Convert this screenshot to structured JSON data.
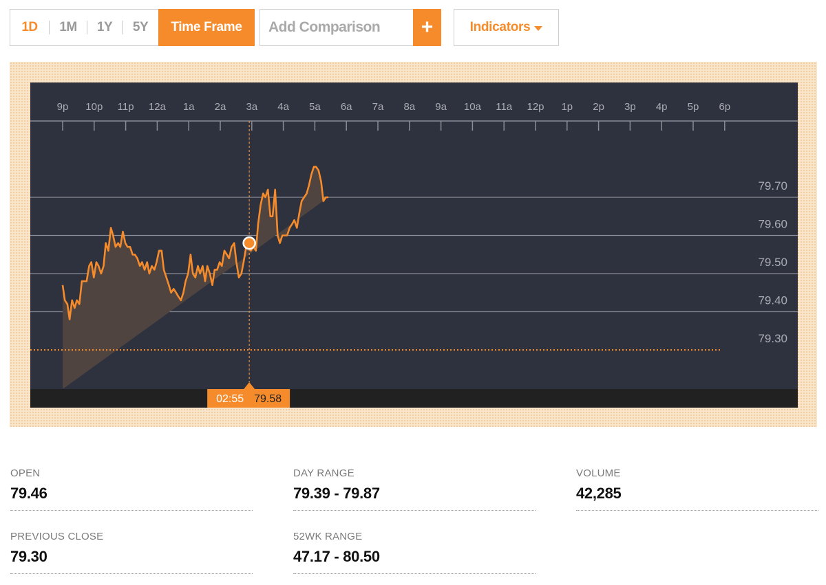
{
  "toolbar": {
    "ranges": [
      {
        "label": "1D",
        "active": true
      },
      {
        "label": "1M",
        "active": false
      },
      {
        "label": "1Y",
        "active": false
      },
      {
        "label": "5Y",
        "active": false
      }
    ],
    "time_frame_label": "Time Frame",
    "comparison_placeholder": "Add Comparison",
    "add_label": "+",
    "indicators_label": "Indicators"
  },
  "colors": {
    "accent": "#f68b2c",
    "plot_bg": "#2d323e",
    "area_fill": "#4f4440",
    "bottom_bar": "#212121",
    "grid": "#8a8d96",
    "axis_text": "#a9acb4"
  },
  "chart_data": {
    "type": "area",
    "x_ticks": [
      "9p",
      "10p",
      "11p",
      "12a",
      "1a",
      "2a",
      "3a",
      "4a",
      "5a",
      "6a",
      "7a",
      "8a",
      "9a",
      "10a",
      "11a",
      "12p",
      "1p",
      "2p",
      "3p",
      "4p",
      "5p",
      "6p"
    ],
    "y_ticks": [
      79.7,
      79.6,
      79.5,
      79.4,
      79.3
    ],
    "ylim": [
      79.16,
      79.82
    ],
    "xlim_hours": [
      -0.57,
      23.8
    ],
    "previous_close": 79.3,
    "series": [
      {
        "x_hours": [
          0,
          0.07,
          0.15,
          0.22,
          0.3,
          0.38,
          0.45,
          0.53,
          0.61,
          0.68,
          0.76,
          0.84,
          0.91,
          0.99,
          1.07,
          1.14,
          1.22,
          1.3,
          1.37,
          1.45,
          1.53,
          1.6,
          1.68,
          1.76,
          1.83,
          1.91,
          1.99,
          2.06,
          2.14,
          2.22,
          2.29,
          2.37,
          2.45,
          2.52,
          2.6,
          2.68,
          2.75,
          2.83,
          2.91,
          2.98,
          3.06,
          3.14,
          3.21,
          3.29,
          3.37,
          3.44,
          3.52,
          3.6,
          3.67,
          3.75,
          3.83,
          3.9,
          3.98,
          4.06,
          4.13,
          4.21,
          4.29,
          4.36,
          4.44,
          4.52,
          4.59,
          4.67,
          4.75,
          4.82,
          4.9,
          4.98,
          5.05,
          5.13,
          5.21,
          5.28,
          5.36,
          5.44,
          5.51,
          5.59,
          5.67,
          5.74,
          5.82,
          5.9,
          5.97,
          6.05,
          6.13,
          6.2,
          6.28,
          6.36,
          6.43,
          6.51,
          6.59,
          6.66,
          6.74,
          6.82,
          6.89,
          6.97,
          7.05,
          7.12,
          7.2,
          7.28,
          7.35,
          7.43,
          7.51,
          7.58,
          7.66,
          7.74,
          7.81,
          7.89,
          7.97,
          8.04,
          8.12,
          8.2,
          8.27,
          8.35,
          8.43,
          8.5,
          8.58,
          8.66,
          8.73,
          8.81,
          8.89,
          8.96,
          9.04,
          9.12,
          9.19,
          9.27,
          9.35,
          9.42,
          9.5,
          9.58,
          9.65,
          9.73,
          9.81,
          9.88,
          9.96
        ],
        "values": [
          79.47,
          79.43,
          79.42,
          79.38,
          79.43,
          79.41,
          79.43,
          79.42,
          79.48,
          79.48,
          79.48,
          79.52,
          79.53,
          79.49,
          79.53,
          79.52,
          79.5,
          79.52,
          79.58,
          79.56,
          79.62,
          79.6,
          79.57,
          79.58,
          79.57,
          79.61,
          79.58,
          79.57,
          79.57,
          79.55,
          79.55,
          79.54,
          79.52,
          79.53,
          79.51,
          79.53,
          79.5,
          79.52,
          79.51,
          79.53,
          79.56,
          79.56,
          79.51,
          79.49,
          79.47,
          79.45,
          79.46,
          79.45,
          79.44,
          79.43,
          79.45,
          79.48,
          79.5,
          79.55,
          79.5,
          79.49,
          79.52,
          79.5,
          79.52,
          79.48,
          79.52,
          79.5,
          79.47,
          79.51,
          79.51,
          79.53,
          79.52,
          79.56,
          79.55,
          79.54,
          79.57,
          79.58,
          79.53,
          79.49,
          79.5,
          79.53,
          79.57,
          79.58,
          79.56,
          79.57,
          79.56,
          79.63,
          79.68,
          79.71,
          79.7,
          79.72,
          79.65,
          79.65,
          79.72,
          79.6,
          79.58,
          79.6,
          79.6,
          79.6,
          79.62,
          79.63,
          79.64,
          79.62,
          79.66,
          79.69,
          79.7,
          79.71,
          79.73,
          79.76,
          79.78,
          79.78,
          79.77,
          79.74,
          79.69,
          79.7,
          79.7
        ],
        "name": ""
      }
    ],
    "crosshair": {
      "time": "02:55",
      "value": 79.58,
      "x_hours": 5.92
    }
  },
  "stats": [
    {
      "label": "OPEN",
      "value": "79.46"
    },
    {
      "label": "DAY RANGE",
      "value": "79.39 - 79.87"
    },
    {
      "label": "VOLUME",
      "value": "42,285"
    },
    {
      "label": "PREVIOUS CLOSE",
      "value": "79.30"
    },
    {
      "label": "52WK RANGE",
      "value": "47.17 - 80.50"
    }
  ]
}
